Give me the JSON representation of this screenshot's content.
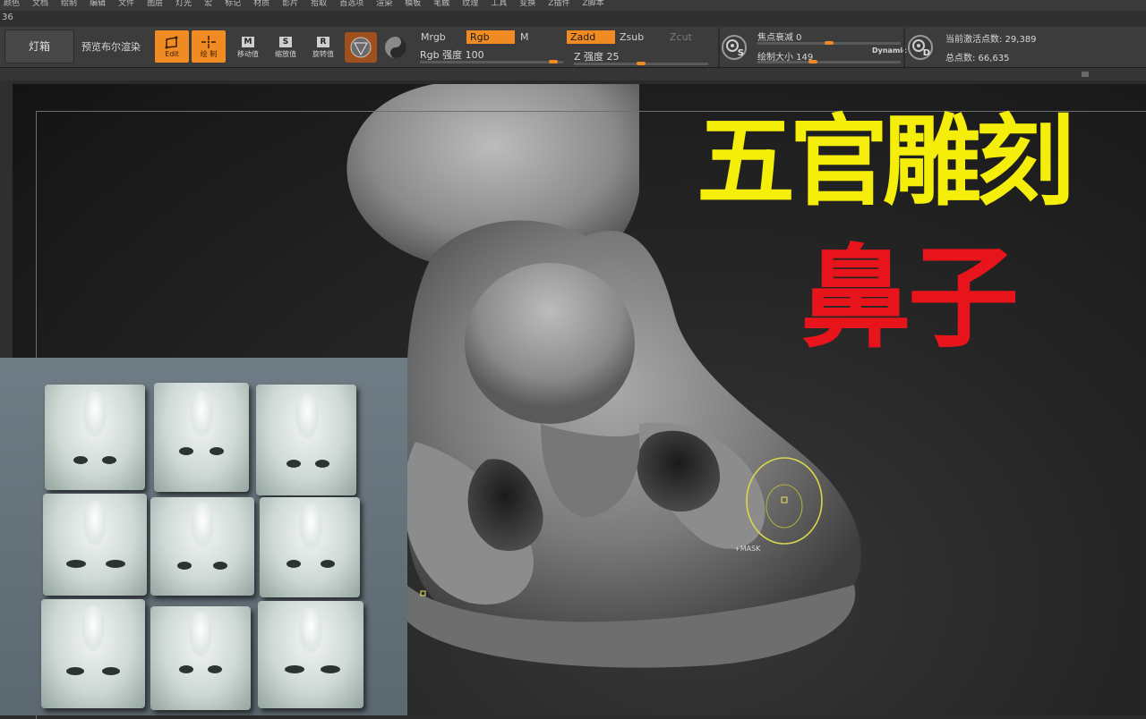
{
  "menubar": {
    "items": [
      "颜色",
      "文档",
      "绘制",
      "编辑",
      "文件",
      "图层",
      "灯光",
      "宏",
      "标记",
      "材质",
      "影片",
      "拾取",
      "首选项",
      "渲染",
      "模板",
      "笔触",
      "纹理",
      "工具",
      "变换",
      "Z插件",
      "Z脚本"
    ]
  },
  "titlestrip": {
    "text": "36"
  },
  "toolbar": {
    "lightbox_label": "灯箱",
    "bpr_label": "预览布尔渲染",
    "edit_label": "Edit",
    "draw_label": "绘 制",
    "move_label": "移动值",
    "scale_label": "缩放值",
    "rotate_label": "旋转值",
    "move_key": "M",
    "scale_key": "S",
    "rotate_key": "R",
    "mrgb": "Mrgb",
    "rgb": "Rgb",
    "m": "M",
    "zadd": "Zadd",
    "zsub": "Zsub",
    "zcut": "Zcut",
    "rgb_intensity": "Rgb 强度 100",
    "z_intensity": "Z 强度 25",
    "focal_shift": "焦点衰减 0",
    "draw_size": "绘制大小 149",
    "dynamic": "Dynamic",
    "active_points": "当前激活点数: 29,389",
    "total_points": "总点数: 66,635",
    "s_letter": "S",
    "d_letter": "D"
  },
  "canvas": {
    "title_line1": "五官雕刻",
    "title_line2": "鼻子",
    "mask_label": "+MASK"
  },
  "colors": {
    "accent": "#f08a22",
    "title_yellow": "#f5ee0a",
    "title_red": "#e8141c"
  }
}
